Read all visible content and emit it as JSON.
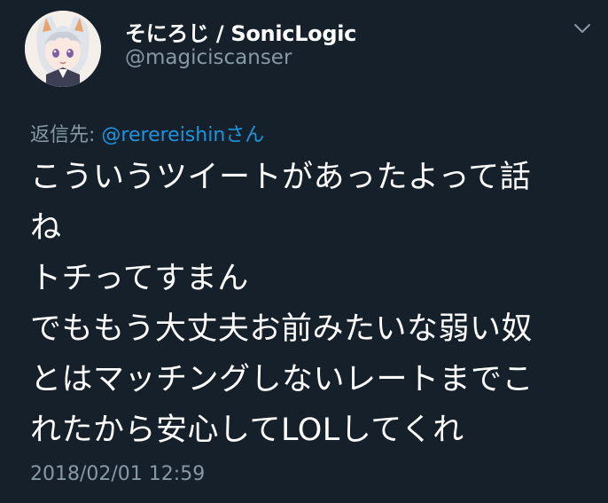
{
  "tweet": {
    "display_name": "そにろじ / SonicLogic",
    "handle": "@magiciscanser",
    "reply": {
      "prefix": "返信先: ",
      "user": "@rerereishin",
      "suffix": "さん"
    },
    "body_lines": [
      "こういうツイートがあったよって話",
      "ね",
      "トチってすまん",
      "でももう大丈夫お前みたいな弱い奴",
      "とはマッチングしないレートまでこ",
      "れたから安心してLOLしてくれ"
    ],
    "timestamp": "2018/02/01 12:59"
  },
  "icons": {
    "menu": "chevron-down-icon",
    "avatar": "avatar"
  },
  "colors": {
    "background": "#15202b",
    "text_primary": "#ffffff",
    "text_secondary": "#8899a6",
    "link": "#1b95e0"
  }
}
